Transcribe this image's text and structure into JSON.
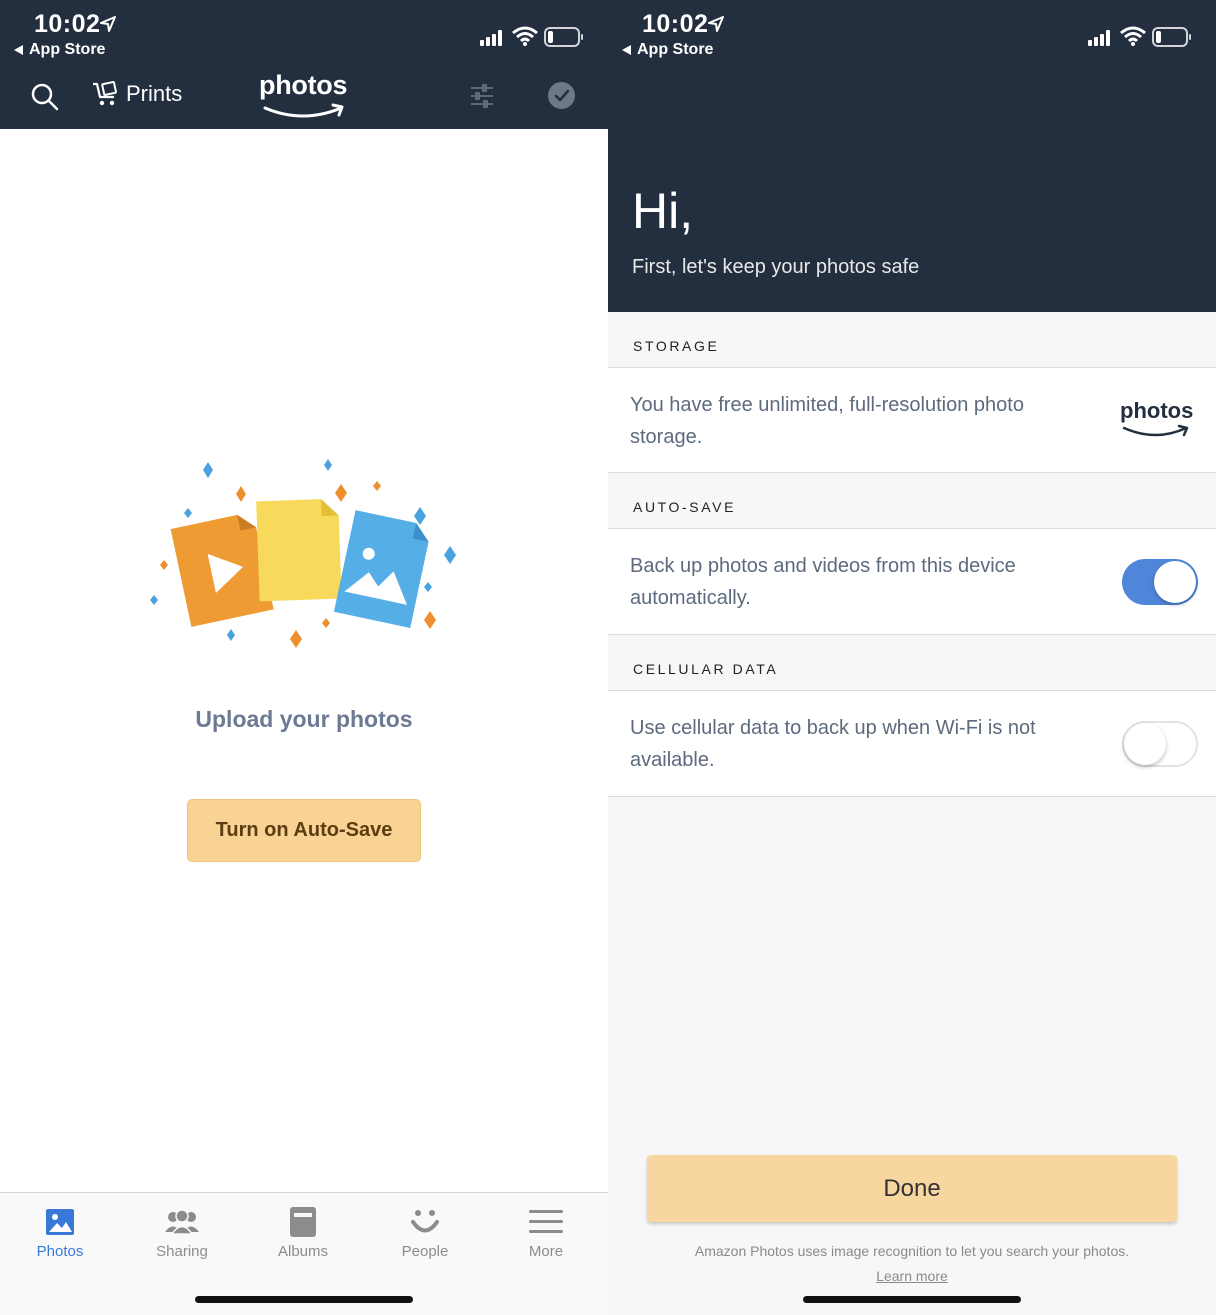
{
  "status_bar": {
    "time": "10:02",
    "back_label": "App Store"
  },
  "left": {
    "nav": {
      "prints_label": "Prints",
      "logo_text": "photos"
    },
    "empty_state": {
      "title": "Upload your photos",
      "button_label": "Turn on Auto-Save"
    },
    "tabs": [
      {
        "label": "Photos",
        "icon": "photo-icon",
        "active": true
      },
      {
        "label": "Sharing",
        "icon": "people-group-icon",
        "active": false
      },
      {
        "label": "Albums",
        "icon": "album-icon",
        "active": false
      },
      {
        "label": "People",
        "icon": "smiley-face-icon",
        "active": false
      },
      {
        "label": "More",
        "icon": "hamburger-menu-icon",
        "active": false
      }
    ]
  },
  "right": {
    "greeting": "Hi,",
    "subtitle": "First, let's keep your photos safe",
    "storage": {
      "label": "STORAGE",
      "text": "You have free unlimited, full-resolution photo storage.",
      "logo_text": "photos"
    },
    "auto_save": {
      "label": "AUTO-SAVE",
      "text": "Back up photos and videos from this device automatically.",
      "enabled": true
    },
    "cellular": {
      "label": "CELLULAR DATA",
      "text": "Use cellular data to back up when Wi-Fi is not available.",
      "enabled": false
    },
    "done_label": "Done",
    "footer_note": "Amazon Photos uses image recognition to let you search your photos.",
    "learn_more": "Learn more"
  },
  "colors": {
    "header_bg": "#232f3e",
    "accent_blue": "#3a78d8",
    "cta_orange": "#f8d393",
    "toggle_on": "#4f86d9"
  }
}
